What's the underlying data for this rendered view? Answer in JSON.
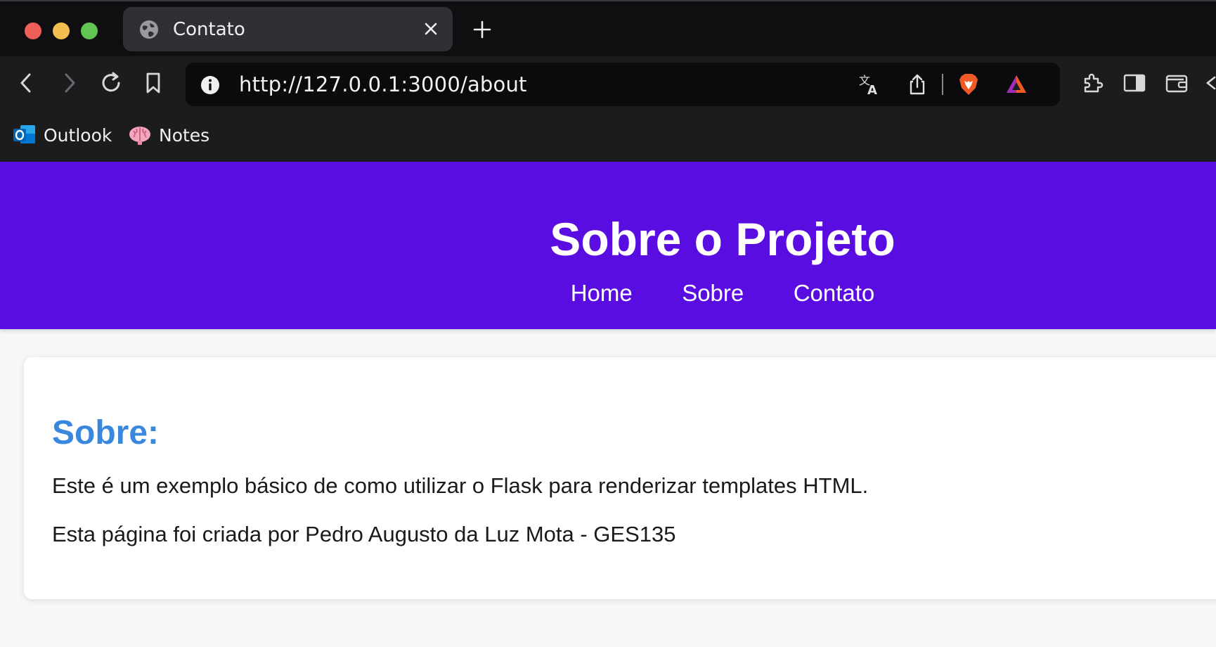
{
  "browser": {
    "tab_title": "Contato",
    "url": "http://127.0.0.1:3000/about",
    "bookmarks": [
      {
        "label": "Outlook",
        "icon": "outlook-icon"
      },
      {
        "label": "Notes",
        "icon": "brain-icon"
      }
    ],
    "colors": {
      "tabbar": "#0f0f12",
      "toolbar": "#1c1c1f",
      "brave": "#f15a24"
    }
  },
  "header": {
    "title": "Sobre o Projeto",
    "nav": [
      "Home",
      "Sobre",
      "Contato"
    ],
    "background": "#5a0de0"
  },
  "content": {
    "heading": "Sobre:",
    "paragraphs": [
      "Este é um exemplo básico de como utilizar o Flask para renderizar templates HTML.",
      "Esta página foi criada por Pedro Augusto da Luz Mota - GES135"
    ],
    "heading_color": "#3a88dd"
  }
}
